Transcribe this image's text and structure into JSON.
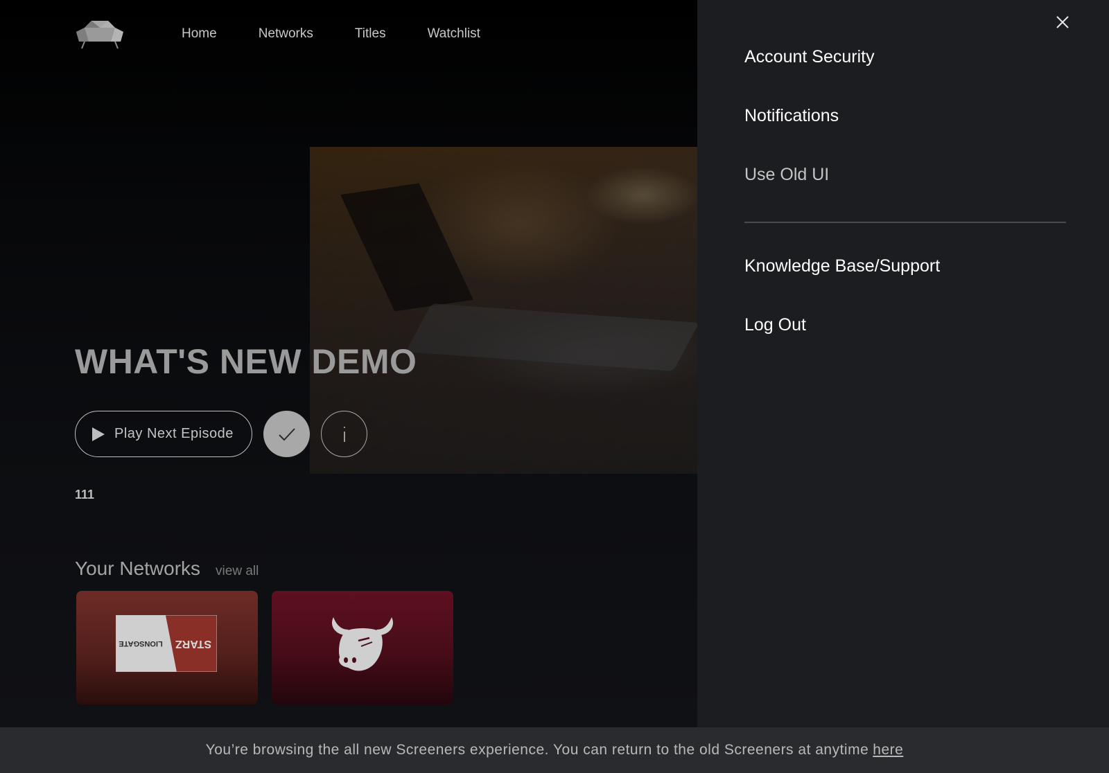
{
  "nav": {
    "items": [
      {
        "label": "Home"
      },
      {
        "label": "Networks"
      },
      {
        "label": "Titles"
      },
      {
        "label": "Watchlist"
      }
    ]
  },
  "hero": {
    "title": "WHAT'S NEW DEMO",
    "play_label": "Play Next Episode",
    "info_label": "i",
    "episode_code": "111"
  },
  "networks": {
    "title": "Your Networks",
    "view_all": "view all",
    "cards": [
      {
        "name": "Lionsgate Starz",
        "left_text": "LIONSGATE",
        "right_text": "STARZ"
      },
      {
        "name": "Bull logo"
      }
    ]
  },
  "menu": {
    "items": [
      {
        "label": "Account Security"
      },
      {
        "label": "Notifications"
      },
      {
        "label": "Use Old UI"
      },
      {
        "label": "Knowledge Base/Support"
      },
      {
        "label": "Log Out"
      }
    ]
  },
  "banner": {
    "text": "You’re browsing the all new Screeners experience. You can return to the old Screeners at anytime",
    "link": "here"
  },
  "colors": {
    "panel_bg": "#1c1d21",
    "banner_bg": "#2a2b2f",
    "card_lionsgate": "#6d2b26",
    "card_bull": "#5e1020"
  },
  "icons": [
    "sofa-logo-icon",
    "play-icon",
    "check-icon",
    "info-icon",
    "close-icon",
    "bull-logo-icon"
  ]
}
